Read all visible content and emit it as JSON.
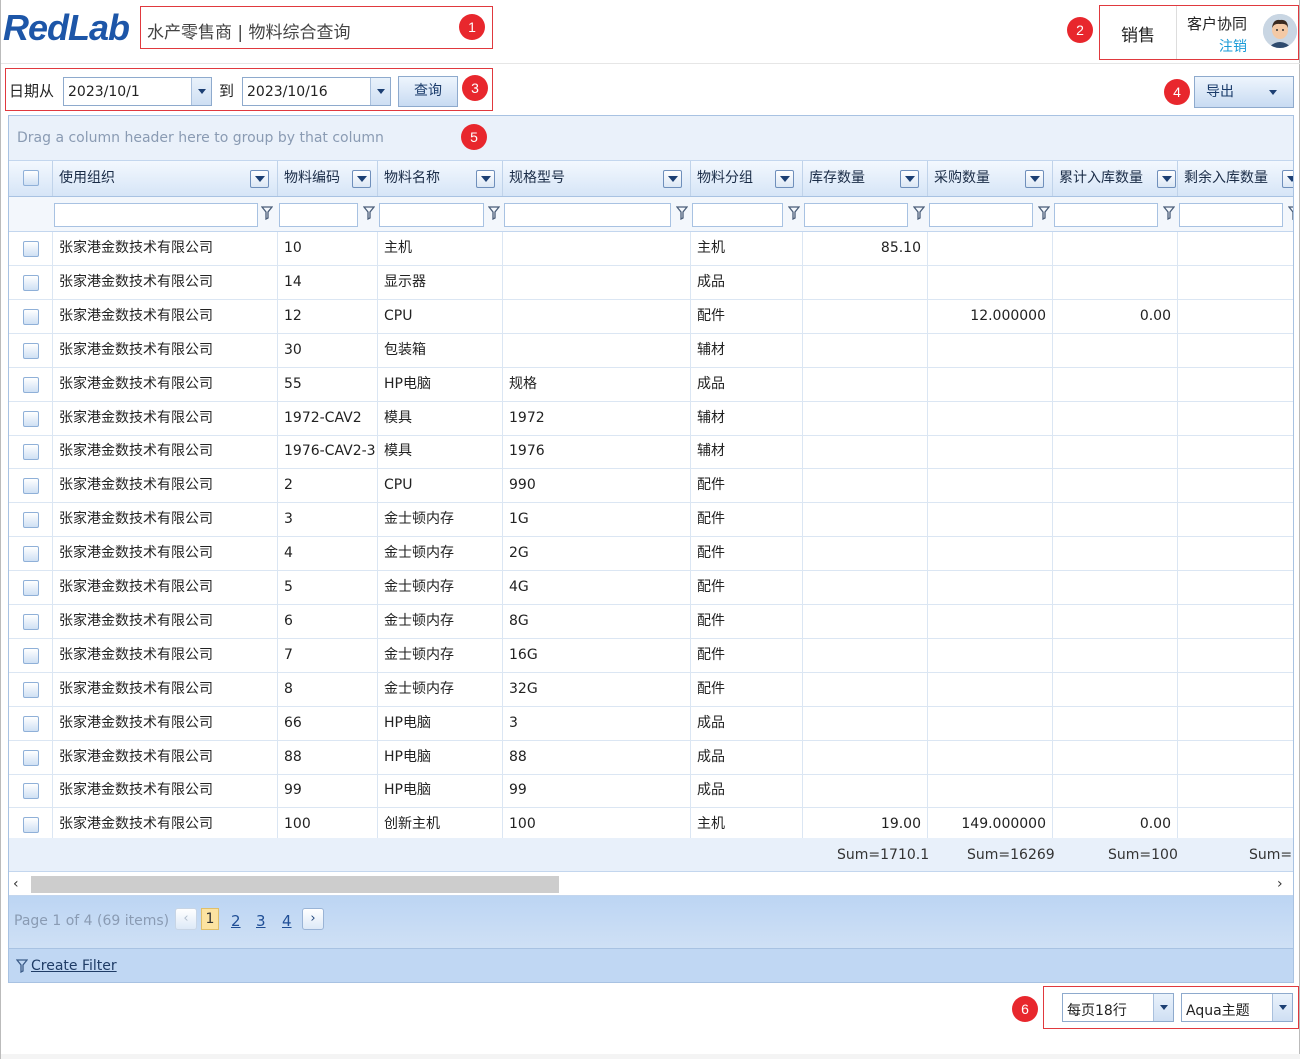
{
  "header": {
    "logo_text": "RedLab",
    "title": "水产零售商 |   物料综合查询",
    "sales": "销售",
    "collab": "客户协同",
    "logout": "注销"
  },
  "badges": [
    "1",
    "2",
    "3",
    "4",
    "5",
    "6"
  ],
  "filter": {
    "date_from_label": "日期从",
    "date_from": "2023/10/1",
    "to_label": "到",
    "date_to": "2023/10/16",
    "query_label": "查询",
    "export_label": "导出"
  },
  "grid": {
    "group_hint": "Drag a column header here to group by that column",
    "columns": [
      "使用组织",
      "物料编码",
      "物料名称",
      "规格型号",
      "物料分组",
      "库存数量",
      "采购数量",
      "累计入库数量",
      "剩余入库数量"
    ],
    "rows": [
      [
        "张家港金数技术有限公司",
        "10",
        "主机",
        "",
        "主机",
        "85.10",
        "",
        "",
        ""
      ],
      [
        "张家港金数技术有限公司",
        "14",
        "显示器",
        "",
        "成品",
        "",
        "",
        "",
        ""
      ],
      [
        "张家港金数技术有限公司",
        "12",
        "CPU",
        "",
        "配件",
        "",
        "12.000000",
        "0.00",
        ""
      ],
      [
        "张家港金数技术有限公司",
        "30",
        "包装箱",
        "",
        "辅材",
        "",
        "",
        "",
        ""
      ],
      [
        "张家港金数技术有限公司",
        "55",
        "HP电脑",
        "规格",
        "成品",
        "",
        "",
        "",
        ""
      ],
      [
        "张家港金数技术有限公司",
        "1972-CAV2",
        "模具",
        "1972",
        "辅材",
        "",
        "",
        "",
        ""
      ],
      [
        "张家港金数技术有限公司",
        "1976-CAV2-3",
        "模具",
        "1976",
        "辅材",
        "",
        "",
        "",
        ""
      ],
      [
        "张家港金数技术有限公司",
        "2",
        "CPU",
        "990",
        "配件",
        "",
        "",
        "",
        ""
      ],
      [
        "张家港金数技术有限公司",
        "3",
        "金士顿内存",
        "1G",
        "配件",
        "",
        "",
        "",
        ""
      ],
      [
        "张家港金数技术有限公司",
        "4",
        "金士顿内存",
        "2G",
        "配件",
        "",
        "",
        "",
        ""
      ],
      [
        "张家港金数技术有限公司",
        "5",
        "金士顿内存",
        "4G",
        "配件",
        "",
        "",
        "",
        ""
      ],
      [
        "张家港金数技术有限公司",
        "6",
        "金士顿内存",
        "8G",
        "配件",
        "",
        "",
        "",
        ""
      ],
      [
        "张家港金数技术有限公司",
        "7",
        "金士顿内存",
        "16G",
        "配件",
        "",
        "",
        "",
        ""
      ],
      [
        "张家港金数技术有限公司",
        "8",
        "金士顿内存",
        "32G",
        "配件",
        "",
        "",
        "",
        ""
      ],
      [
        "张家港金数技术有限公司",
        "66",
        "HP电脑",
        "3",
        "成品",
        "",
        "",
        "",
        ""
      ],
      [
        "张家港金数技术有限公司",
        "88",
        "HP电脑",
        "88",
        "成品",
        "",
        "",
        "",
        ""
      ],
      [
        "张家港金数技术有限公司",
        "99",
        "HP电脑",
        "99",
        "成品",
        "",
        "",
        "",
        ""
      ],
      [
        "张家港金数技术有限公司",
        "100",
        "创新主机",
        "100",
        "主机",
        "19.00",
        "149.000000",
        "0.00",
        ""
      ]
    ],
    "sums": [
      "Sum=1710.1",
      "Sum=16269",
      "Sum=100",
      "Sum=("
    ],
    "pager_info": "Page 1 of 4 (69 items)",
    "pages": [
      "1",
      "2",
      "3",
      "4"
    ],
    "current_page": "1",
    "create_filter": "Create Filter"
  },
  "footer": {
    "page_size": "每页18行",
    "theme": "Aqua主题"
  }
}
